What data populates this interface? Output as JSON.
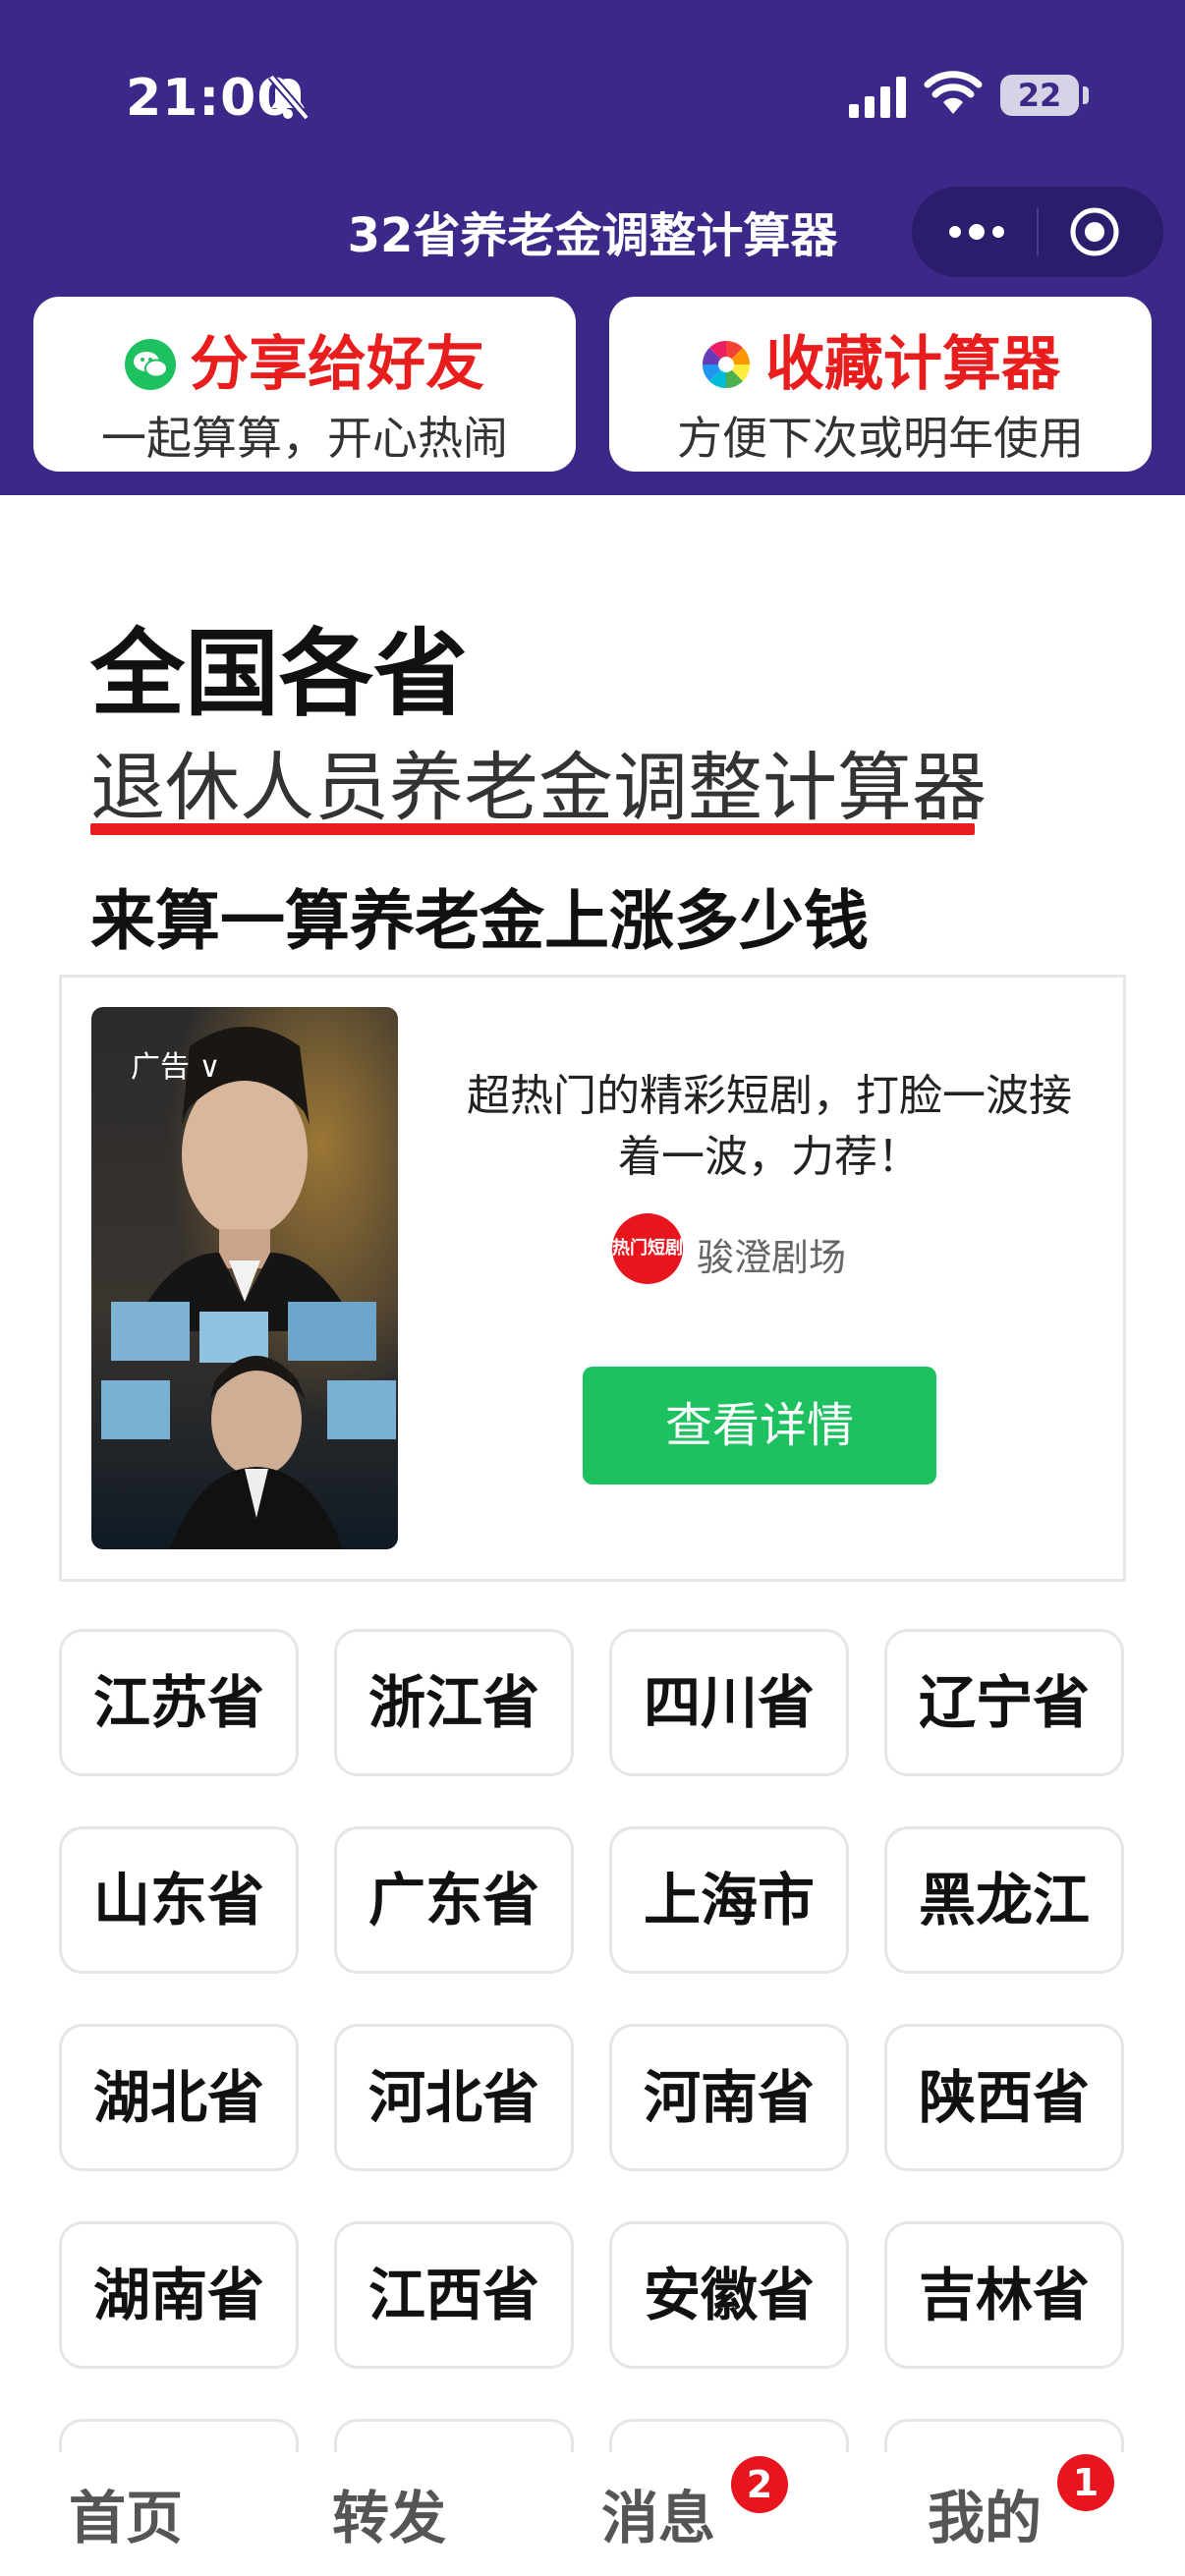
{
  "status_bar": {
    "time": "21:00",
    "battery": "22"
  },
  "nav": {
    "title": "32省养老金调整计算器"
  },
  "promos": {
    "share": {
      "title": "分享给好友",
      "subtitle": "一起算算，开心热闹"
    },
    "collect": {
      "title": "收藏计算器",
      "subtitle": "方便下次或明年使用"
    }
  },
  "hero": {
    "title": "全国各省",
    "subtitle": "退休人员养老金调整计算器",
    "tagline": "来算一算养老金上涨多少钱"
  },
  "ad": {
    "label": "广告",
    "description": "超热门的精彩短剧，打脸一波接着一波，力荐！",
    "brand_logo_text": "热门短剧",
    "brand_name": "骏澄剧场",
    "button": "查看详情"
  },
  "provinces": [
    "江苏省",
    "浙江省",
    "四川省",
    "辽宁省",
    "山东省",
    "广东省",
    "上海市",
    "黑龙江",
    "湖北省",
    "河北省",
    "河南省",
    "陕西省",
    "湖南省",
    "江西省",
    "安徽省",
    "吉林省"
  ],
  "tabs": [
    {
      "label": "首页",
      "badge": ""
    },
    {
      "label": "转发",
      "badge": ""
    },
    {
      "label": "消息",
      "badge": "2"
    },
    {
      "label": "我的",
      "badge": "1"
    }
  ],
  "colors": {
    "header": "#3c2888",
    "accent_red": "#e81d1d",
    "button_green": "#1dc15f"
  }
}
